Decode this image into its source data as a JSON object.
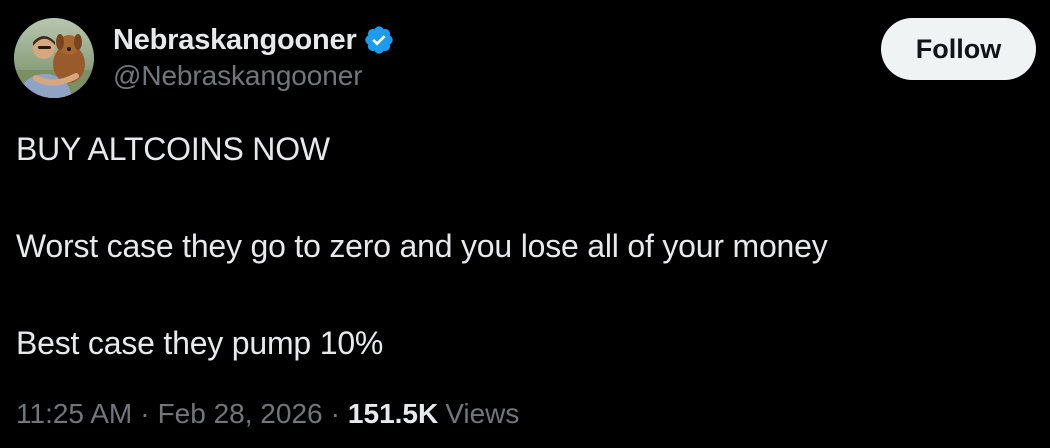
{
  "author": {
    "display_name": "Nebraskangooner",
    "handle": "@Nebraskangooner",
    "verified": true,
    "badge_color": "#1d9bf0"
  },
  "follow_button": {
    "label": "Follow"
  },
  "tweet": {
    "lines": [
      "BUY ALTCOINS NOW",
      "Worst case they go to zero and you lose all of your money",
      "Best case they pump 10%"
    ]
  },
  "meta": {
    "time": "11:25 AM",
    "separator": "·",
    "date": "Feb 28, 2026",
    "views_count": "151.5K",
    "views_label": "Views"
  },
  "colors": {
    "background": "#000000",
    "primary_text": "#e7e9ea",
    "secondary_text": "#71767b",
    "button_bg": "#eff3f4",
    "button_text": "#0f1419"
  },
  "icons": {
    "verified": "verified-badge-icon"
  }
}
